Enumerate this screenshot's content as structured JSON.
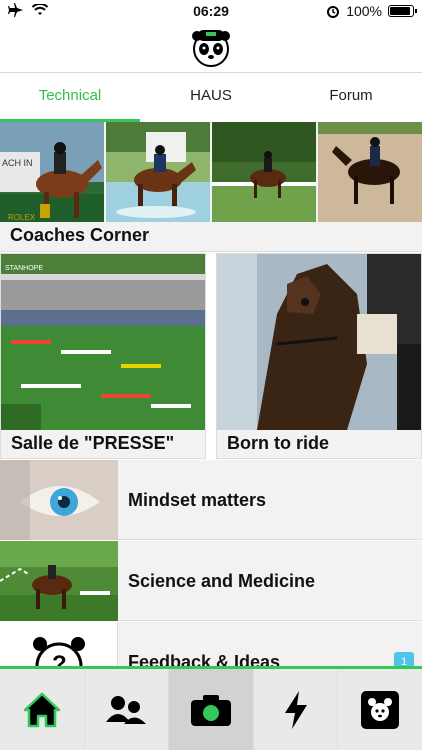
{
  "status": {
    "time": "06:29",
    "battery": "100%"
  },
  "tabs": [
    {
      "label": "Technical",
      "active": true
    },
    {
      "label": "HAUS",
      "active": false
    },
    {
      "label": "Forum",
      "active": false
    }
  ],
  "colors": {
    "accent": "#34c759",
    "badge": "#4fc3e8"
  },
  "sections": {
    "coaches_corner": "Coaches Corner",
    "salle": "Salle de \"PRESSE\"",
    "born": "Born to ride"
  },
  "rows": [
    {
      "label": "Mindset matters",
      "icon": "eye-photo"
    },
    {
      "label": "Science and Medicine",
      "icon": "horse-jump-photo"
    },
    {
      "label": "Feedback & Ideas",
      "icon": "panda-question-icon",
      "badge": "1"
    }
  ],
  "bottom_nav": [
    {
      "icon": "home-icon",
      "active": true
    },
    {
      "icon": "people-icon",
      "active": false
    },
    {
      "icon": "camera-icon",
      "active": true
    },
    {
      "icon": "lightning-icon",
      "active": false
    },
    {
      "icon": "profile-icon",
      "active": false
    }
  ]
}
